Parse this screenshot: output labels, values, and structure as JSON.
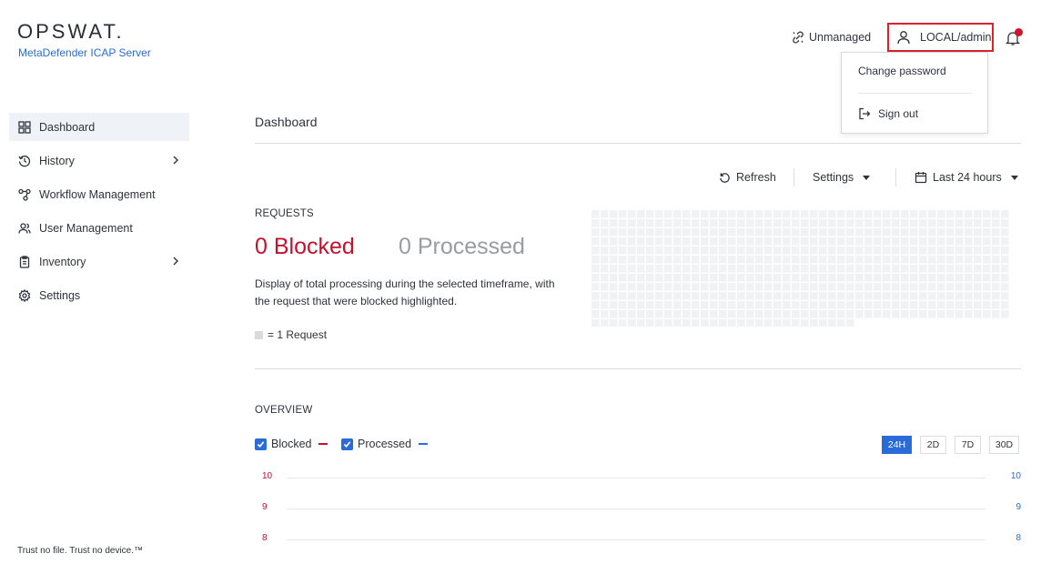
{
  "brand": {
    "logo": "OPSWAT.",
    "product": "MetaDefender ICAP Server",
    "tagline": "Trust no file. Trust no device.™"
  },
  "sidebar": {
    "items": [
      {
        "label": "Dashboard",
        "icon": "dashboard-grid-icon",
        "active": true
      },
      {
        "label": "History",
        "icon": "history-icon",
        "expandable": true
      },
      {
        "label": "Workflow Management",
        "icon": "workflow-icon"
      },
      {
        "label": "User Management",
        "icon": "users-icon"
      },
      {
        "label": "Inventory",
        "icon": "clipboard-icon",
        "expandable": true
      },
      {
        "label": "Settings",
        "icon": "gear-icon"
      }
    ]
  },
  "header": {
    "unmanaged_label": "Unmanaged",
    "user_label": "LOCAL/admin",
    "dropdown": {
      "change_password": "Change password",
      "sign_out": "Sign out"
    }
  },
  "main": {
    "title": "Dashboard",
    "toolbar": {
      "refresh": "Refresh",
      "settings": "Settings",
      "timeframe": "Last 24 hours"
    },
    "requests": {
      "label": "REQUESTS",
      "blocked": "0 Blocked",
      "processed": "0 Processed",
      "description": "Display of total processing during the selected timeframe, with the request that were blocked highlighted.",
      "legend": "= 1 Request"
    },
    "overview": {
      "label": "OVERVIEW",
      "series": [
        {
          "label": "Blocked",
          "color": "#c8102e",
          "checked": true
        },
        {
          "label": "Processed",
          "color": "#2a6bd9",
          "checked": true
        }
      ],
      "ranges": [
        "24H",
        "2D",
        "7D",
        "30D"
      ],
      "active_range": "24H",
      "left_ticks": [
        "10",
        "9",
        "8"
      ],
      "right_ticks": [
        "10",
        "9",
        "8"
      ]
    }
  },
  "colors": {
    "accent": "#2a6bd9",
    "blocked": "#c8102e",
    "highlight_border": "#d9232e",
    "grid_cell": "#f1f2f4"
  }
}
